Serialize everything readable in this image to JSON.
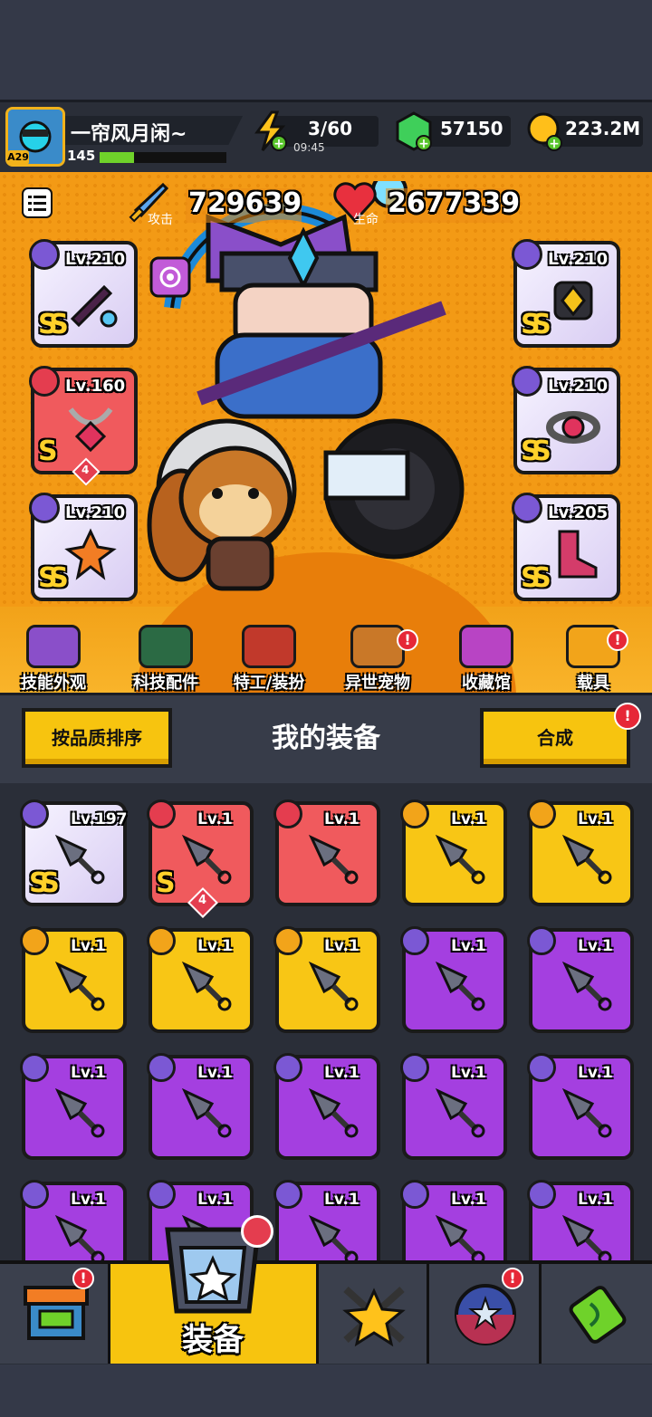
{
  "header": {
    "avatar_tag": "A29",
    "player_name": "一帘风月闲~",
    "player_level": "145",
    "energy": "3/60",
    "energy_timer": "09:45",
    "gems": "57150",
    "coins": "223.2M"
  },
  "hero": {
    "attack_label": "攻击",
    "attack_value": "729639",
    "hp_label": "生命",
    "hp_value": "2677339",
    "slots": [
      {
        "level": "Lv.210",
        "rank": "SS"
      },
      {
        "level": "Lv.160",
        "rank": "S",
        "stars": "4"
      },
      {
        "level": "Lv.210",
        "rank": "SS"
      },
      {
        "level": "Lv.210",
        "rank": "SS"
      },
      {
        "level": "Lv.210",
        "rank": "SS"
      },
      {
        "level": "Lv.205",
        "rank": "SS"
      }
    ]
  },
  "menu": [
    {
      "label": "技能外观"
    },
    {
      "label": "科技配件"
    },
    {
      "label": "特工/装扮"
    },
    {
      "label": "异世宠物",
      "alert": "!"
    },
    {
      "label": "收藏馆"
    },
    {
      "label": "载具",
      "alert": "!"
    }
  ],
  "equipment": {
    "sort_button": "按品质排序",
    "title": "我的装备",
    "merge_button": "合成",
    "merge_alert": "!",
    "items": [
      {
        "level": "Lv.197",
        "rank": "SS",
        "tier": "ss"
      },
      {
        "level": "Lv.1",
        "rank": "S",
        "tier": "red",
        "stars": "4"
      },
      {
        "level": "Lv.1",
        "tier": "red"
      },
      {
        "level": "Lv.1",
        "tier": "gold"
      },
      {
        "level": "Lv.1",
        "tier": "gold"
      },
      {
        "level": "Lv.1",
        "tier": "gold"
      },
      {
        "level": "Lv.1",
        "tier": "gold"
      },
      {
        "level": "Lv.1",
        "tier": "gold"
      },
      {
        "level": "Lv.1",
        "tier": "purple"
      },
      {
        "level": "Lv.1",
        "tier": "purple"
      },
      {
        "level": "Lv.1",
        "tier": "purple"
      },
      {
        "level": "Lv.1",
        "tier": "purple"
      },
      {
        "level": "Lv.1",
        "tier": "purple"
      },
      {
        "level": "Lv.1",
        "tier": "purple"
      },
      {
        "level": "Lv.1",
        "tier": "purple"
      },
      {
        "level": "Lv.1",
        "tier": "purple"
      },
      {
        "level": "Lv.1",
        "tier": "purple"
      },
      {
        "level": "Lv.1",
        "tier": "purple"
      },
      {
        "level": "Lv.1",
        "tier": "purple"
      },
      {
        "level": "Lv.1",
        "tier": "purple"
      }
    ]
  },
  "nav": {
    "equip_label": "装备",
    "shop_alert": "!",
    "gacha_alert": "!"
  },
  "colors": {
    "hero_bg": "#f39a15",
    "gold_tier": "#f8c615",
    "purple_tier": "#a43fe0",
    "red_tier": "#f05a5d",
    "accent_yellow": "#f7c40f"
  }
}
